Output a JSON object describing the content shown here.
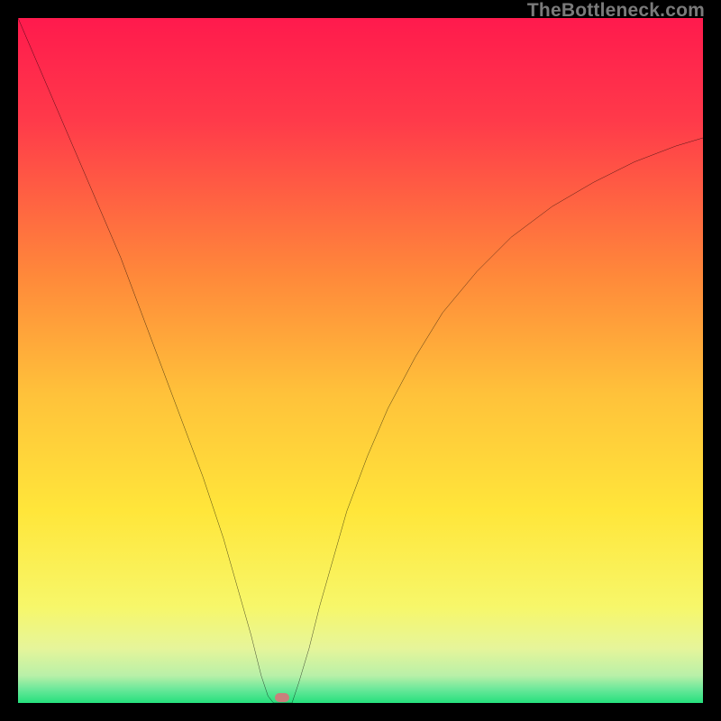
{
  "watermark": "TheBottleneck.com",
  "colors": {
    "black": "#000000",
    "curve": "#000000",
    "marker": "#c9807c",
    "gradient_stops": [
      {
        "pct": 0,
        "color": "#ff1a4d"
      },
      {
        "pct": 15,
        "color": "#ff3a4a"
      },
      {
        "pct": 38,
        "color": "#ff8a3a"
      },
      {
        "pct": 55,
        "color": "#ffc23a"
      },
      {
        "pct": 72,
        "color": "#ffe63a"
      },
      {
        "pct": 86,
        "color": "#f7f76a"
      },
      {
        "pct": 92,
        "color": "#e6f59a"
      },
      {
        "pct": 96,
        "color": "#b9f0a8"
      },
      {
        "pct": 98,
        "color": "#6be89a"
      },
      {
        "pct": 100,
        "color": "#25e07c"
      }
    ]
  },
  "chart_data": {
    "type": "line",
    "title": "",
    "xlabel": "",
    "ylabel": "",
    "xlim": [
      0,
      100
    ],
    "ylim": [
      0,
      100
    ],
    "grid": false,
    "legend": false,
    "annotations": [
      "TheBottleneck.com"
    ],
    "note": "Axes are unlabeled; x represents position across the plot (0=left,100=right) and y represents the curve height as a percentage of plot height (0=bottom,100=top). Values are visually estimated.",
    "series": [
      {
        "name": "left-branch",
        "x": [
          0,
          3,
          6,
          9,
          12,
          15,
          18,
          21,
          24,
          27,
          30,
          32,
          34,
          35.5,
          36.5,
          37.3
        ],
        "y": [
          100,
          93,
          86,
          79,
          72,
          65,
          57,
          49,
          41,
          33,
          24,
          17,
          10,
          4,
          1,
          0
        ]
      },
      {
        "name": "floor",
        "x": [
          37.3,
          40.0
        ],
        "y": [
          0,
          0
        ]
      },
      {
        "name": "right-branch",
        "x": [
          40.0,
          41,
          42.5,
          44,
          46,
          48,
          51,
          54,
          58,
          62,
          67,
          72,
          78,
          84,
          90,
          96,
          100
        ],
        "y": [
          0,
          3,
          8,
          14,
          21,
          28,
          36,
          43,
          50.5,
          57,
          63,
          68,
          72.5,
          76,
          79,
          81.3,
          82.5
        ]
      }
    ],
    "marker": {
      "x": 38.5,
      "y": 0.5,
      "shape": "pill",
      "color": "#c9807c"
    }
  }
}
